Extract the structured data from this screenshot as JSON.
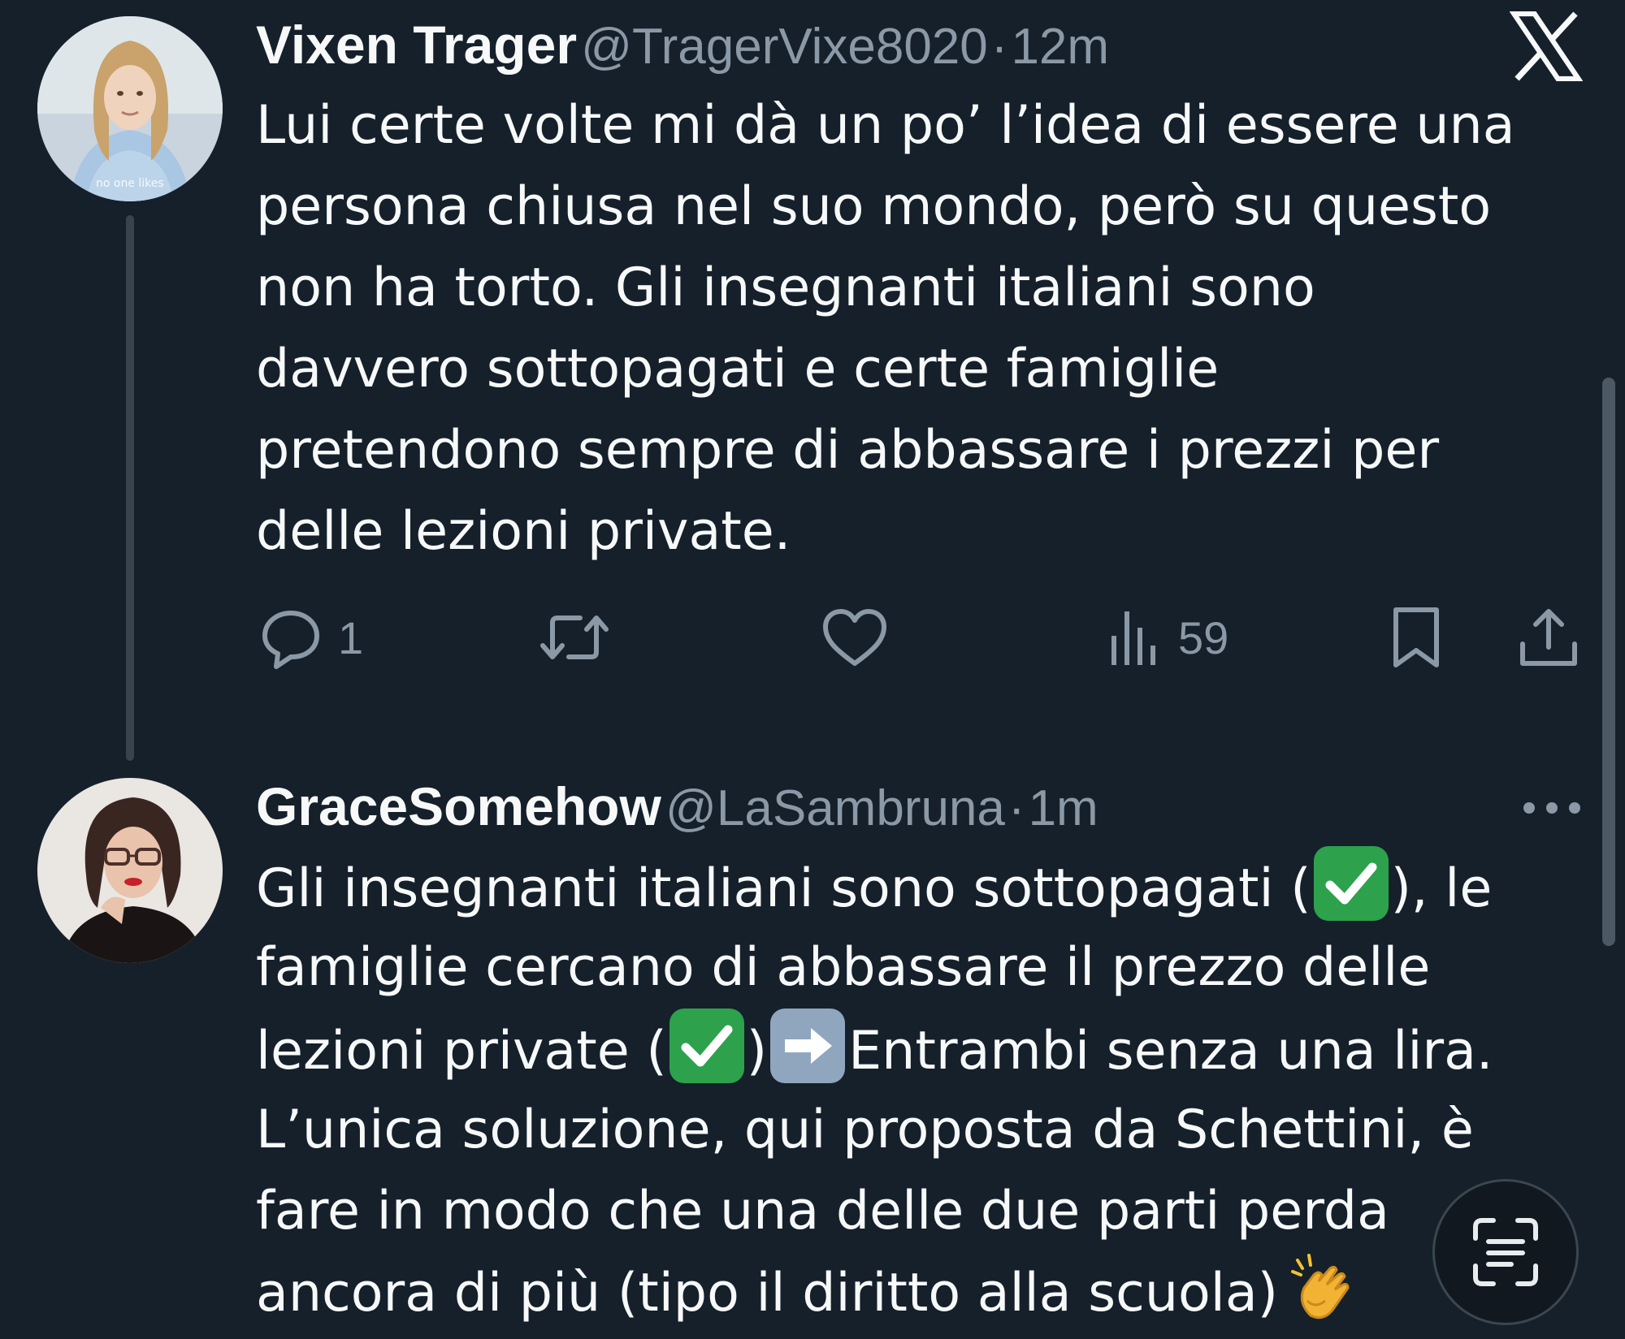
{
  "app": {
    "colors": {
      "background": "#15202b",
      "text_primary": "#f7f9f9",
      "text_secondary": "#8b98a5",
      "thread_line": "#38444d"
    }
  },
  "logo": {
    "icon": "x-logo-icon"
  },
  "tweets": [
    {
      "display_name": "Vixen Trager",
      "handle": "@TragerVixe8020",
      "separator": "·",
      "time": "12m",
      "avatar_caption": "no one likes",
      "text_lines": [
        "Lui certe volte mi dà un po’ l’idea di essere una",
        "persona chiusa nel suo mondo, però su questo",
        "non ha torto. Gli insegnanti italiani sono",
        "davvero sottopagati e certe famiglie",
        "pretendono sempre di abbassare i prezzi per",
        "delle lezioni private."
      ],
      "actions": {
        "reply_count": "1",
        "retweet_count": "",
        "like_count": "",
        "views_count": "59"
      }
    },
    {
      "display_name": "GraceSomehow",
      "handle": "@LaSambruna",
      "separator": "·",
      "time": "1m",
      "more_icon": "more-horizontal-icon",
      "segments": {
        "l1a": "Gli insegnanti italiani sono sottopagati (",
        "l1b": "), le",
        "l2": "famiglie cercano di abbassare il prezzo delle",
        "l3a": "lezioni private (",
        "l3b": ")",
        "l3c": "Entrambi senza una lira.",
        "l4": "L’unica soluzione, qui proposta da Schettini, è",
        "l5": "fare in modo che una delle due parti perda",
        "l6": "ancora di più (tipo il diritto alla scuola)"
      },
      "emojis": [
        "check-mark-button",
        "check-mark-button",
        "right-arrow",
        "clapping-hands"
      ]
    }
  ],
  "floating": {
    "scan_icon": "text-scan-icon"
  }
}
